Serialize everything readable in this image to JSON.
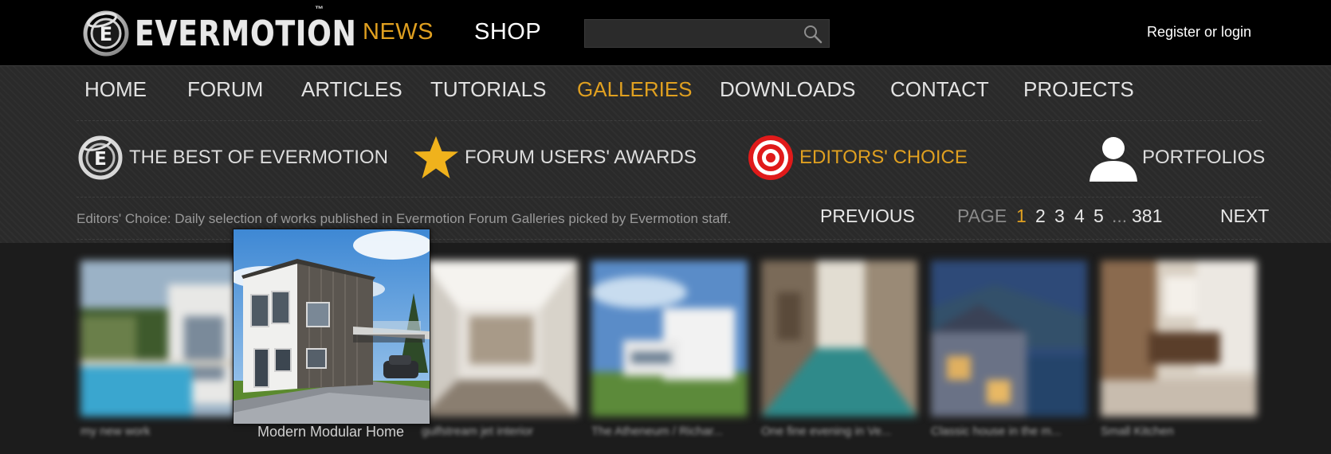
{
  "header": {
    "logo_text": "EVERMOTION",
    "logo_tm": "™",
    "nav_news": "NEWS",
    "nav_shop": "SHOP",
    "search_placeholder": "",
    "login_link": "Register or login"
  },
  "main_nav": {
    "items": [
      "HOME",
      "FORUM",
      "ARTICLES",
      "TUTORIALS",
      "GALLERIES",
      "DOWNLOADS",
      "CONTACT",
      "PROJECTS"
    ],
    "active": "GALLERIES"
  },
  "sub_nav": {
    "items": [
      {
        "label": "THE BEST OF EVERMOTION",
        "icon": "evermotion-logo-icon"
      },
      {
        "label": "FORUM USERS' AWARDS",
        "icon": "star-icon"
      },
      {
        "label": "EDITORS' CHOICE",
        "icon": "target-icon"
      },
      {
        "label": "PORTFOLIOS",
        "icon": "user-icon"
      }
    ],
    "active": "EDITORS' CHOICE"
  },
  "description": "Editors' Choice: Daily selection of works published in Evermotion Forum Galleries picked by Evermotion staff.",
  "pager": {
    "previous": "PREVIOUS",
    "page_label": "PAGE",
    "pages": [
      "1",
      "2",
      "3",
      "4",
      "5",
      "...",
      "381"
    ],
    "current": "1",
    "next": "NEXT"
  },
  "gallery": {
    "thumbnails": [
      {
        "caption": "my new work"
      },
      {
        "caption": "Modern Modular Home"
      },
      {
        "caption": "gulfstream jet interior"
      },
      {
        "caption": "The Atheneum / Richar..."
      },
      {
        "caption": "One fine evening in Ve..."
      },
      {
        "caption": "Classic house in the m..."
      },
      {
        "caption": "Small Kitchen"
      }
    ],
    "hovered_caption": "Modern Modular Home"
  },
  "colors": {
    "accent": "#e0a020",
    "topbar_bg": "#000000",
    "band_bg": "#2a2a2a",
    "page_bg": "#1c1c1c"
  }
}
